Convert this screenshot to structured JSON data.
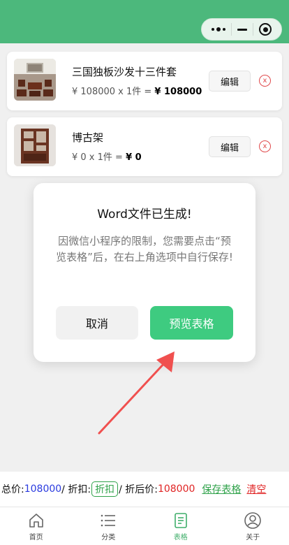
{
  "colors": {
    "header": "#4cb87c",
    "primary": "#3ecb80",
    "danger": "#e02424",
    "total_price": "#2a3adf",
    "link_green": "#2fa24a"
  },
  "capsule": {
    "more_icon": "dots-icon",
    "minimize_icon": "minus-icon",
    "close_icon": "target-circle-icon"
  },
  "items": [
    {
      "name": "三国独板沙发十三件套",
      "price_prefix": "¥ 108000 x 1件 = ",
      "total": "¥ 108000",
      "edit_label": "编辑",
      "delete_glyph": "x"
    },
    {
      "name": "博古架",
      "price_prefix": "¥ 0 x 1件 = ",
      "total": "¥ 0",
      "edit_label": "编辑",
      "delete_glyph": "x"
    }
  ],
  "dialog": {
    "title": "Word文件已生成!",
    "body": "因微信小程序的限制，您需要点击“预览表格”后，在右上角选项中自行保存!",
    "cancel_label": "取消",
    "confirm_label": "预览表格"
  },
  "summary": {
    "total_label": "总价:",
    "total_value": "108000",
    "sep1": "/ 折扣:",
    "discount_tag": "折扣",
    "sep2": "/ 折后价:",
    "final_value": "108000",
    "save_label": "保存表格",
    "clear_label": "清空"
  },
  "tabs": [
    {
      "label": "首页",
      "icon": "home-icon"
    },
    {
      "label": "分类",
      "icon": "list-icon"
    },
    {
      "label": "表格",
      "icon": "document-icon",
      "active": true
    },
    {
      "label": "关于",
      "icon": "user-icon"
    }
  ]
}
